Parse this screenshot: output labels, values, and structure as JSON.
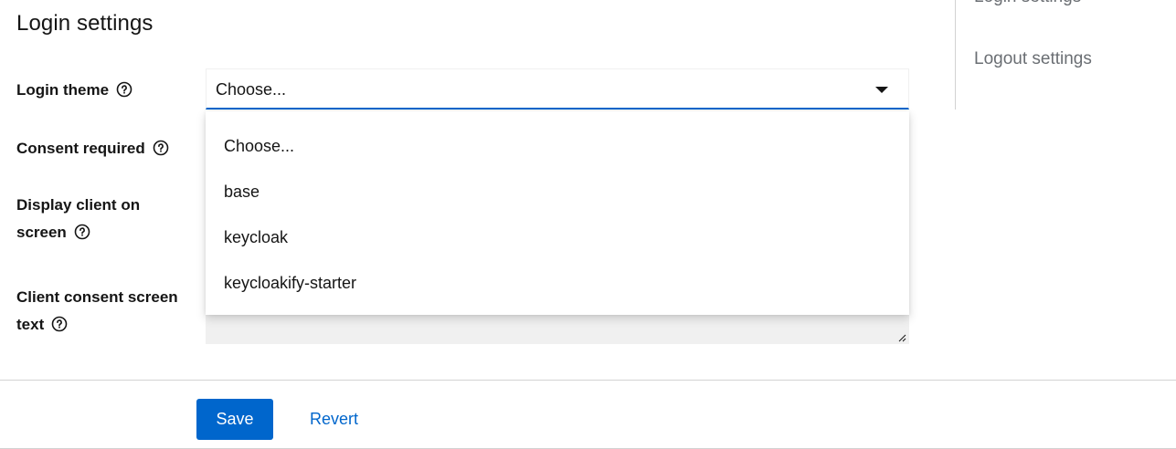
{
  "section_title": "Login settings",
  "jump_links": {
    "login_settings": "Login settings",
    "logout_settings": "Logout settings"
  },
  "fields": {
    "login_theme": {
      "label": "Login theme",
      "value": "Choose..."
    },
    "consent_required": {
      "label": "Consent required"
    },
    "display_client": {
      "label_line1": "Display client on",
      "label_line2": "screen"
    },
    "consent_text": {
      "label_line1": "Client consent screen",
      "label_line2": "text"
    }
  },
  "theme_options": [
    "Choose...",
    "base",
    "keycloak",
    "keycloakify-starter"
  ],
  "actions": {
    "save": "Save",
    "revert": "Revert"
  },
  "colors": {
    "primary": "#0066cc",
    "text": "#151515",
    "muted": "#6a6e73",
    "divider": "#d2d2d2"
  }
}
